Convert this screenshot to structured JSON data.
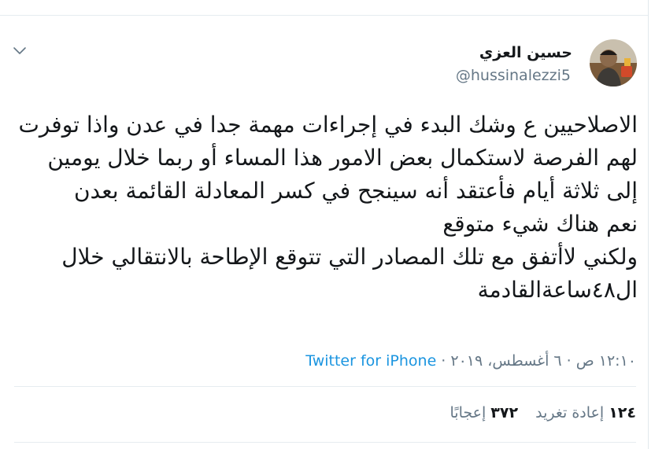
{
  "tweet": {
    "display_name": "حسين العزي",
    "handle": "@hussinalezzi5",
    "text": "الاصلاحيين ع وشك البدء في إجراءات مهمة جدا في عدن واذا توفرت لهم الفرصة لاستكمال بعض الامور هذا المساء أو ربما خلال يومين إلى ثلاثة أيام فأعتقد أنه سينجح في كسر المعادلة القائمة بعدن\nنعم هناك شيء متوقع\nولكني لاأتفق مع تلك المصادر التي تتوقع الإطاحة بالانتقالي خلال ال٤٨ساعةالقادمة",
    "timestamp": "١٢:١٠ ص · ٦ أغسطس، ٢٠١٩",
    "separator": " · ",
    "source": "Twitter for iPhone"
  },
  "stats": {
    "retweets_count": "١٢٤",
    "retweets_label": "إعادة تغريد",
    "likes_count": "٣٧٢",
    "likes_label": "إعجابًا"
  },
  "icons": {
    "caret": "chevron-down-icon",
    "avatar": "user-avatar"
  },
  "colors": {
    "text": "#14171a",
    "secondary": "#657786",
    "link": "#1b95e0",
    "divider": "#e6ecf0"
  }
}
